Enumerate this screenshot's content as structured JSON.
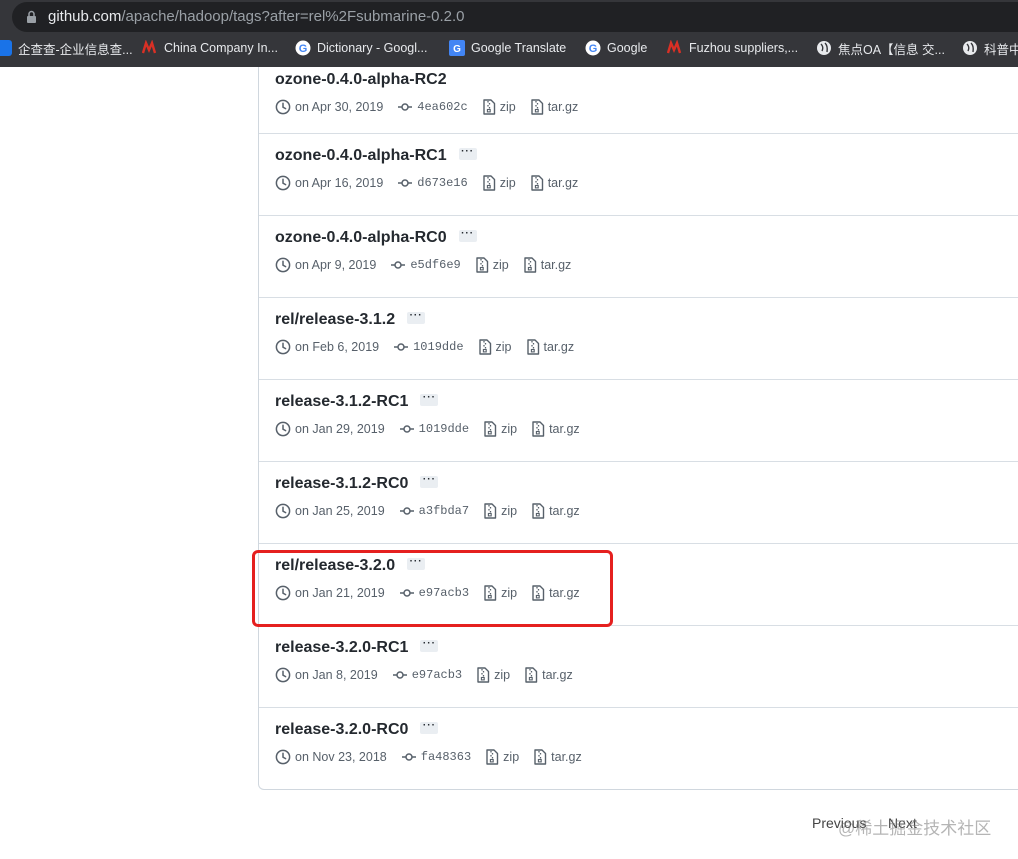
{
  "browser": {
    "url_host": "github.com",
    "url_path": "/apache/hadoop/tags?after=rel%2Fsubmarine-0.2.0",
    "bookmarks": [
      {
        "label": "企查查-企业信息查...",
        "icon": "qichacha-icon"
      },
      {
        "label": "China Company In...",
        "icon": "made-in-china-icon"
      },
      {
        "label": "Dictionary - Googl...",
        "icon": "google-icon"
      },
      {
        "label": "Google Translate",
        "icon": "google-translate-icon"
      },
      {
        "label": "Google",
        "icon": "google-icon"
      },
      {
        "label": "Fuzhou suppliers,...",
        "icon": "made-in-china-icon"
      },
      {
        "label": "焦点OA【信息 交...",
        "icon": "globe-icon"
      },
      {
        "label": "科普中",
        "icon": "globe-icon"
      }
    ]
  },
  "tags": [
    {
      "name": "ozone-0.4.0-alpha-RC2",
      "date": "on Apr 30, 2019",
      "sha": "4ea602c",
      "zip": "zip",
      "targz": "tar.gz"
    },
    {
      "name": "ozone-0.4.0-alpha-RC1",
      "date": "on Apr 16, 2019",
      "sha": "d673e16",
      "zip": "zip",
      "targz": "tar.gz"
    },
    {
      "name": "ozone-0.4.0-alpha-RC0",
      "date": "on Apr 9, 2019",
      "sha": "e5df6e9",
      "zip": "zip",
      "targz": "tar.gz"
    },
    {
      "name": "rel/release-3.1.2",
      "date": "on Feb 6, 2019",
      "sha": "1019dde",
      "zip": "zip",
      "targz": "tar.gz"
    },
    {
      "name": "release-3.1.2-RC1",
      "date": "on Jan 29, 2019",
      "sha": "1019dde",
      "zip": "zip",
      "targz": "tar.gz"
    },
    {
      "name": "release-3.1.2-RC0",
      "date": "on Jan 25, 2019",
      "sha": "a3fbda7",
      "zip": "zip",
      "targz": "tar.gz"
    },
    {
      "name": "rel/release-3.2.0",
      "date": "on Jan 21, 2019",
      "sha": "e97acb3",
      "zip": "zip",
      "targz": "tar.gz"
    },
    {
      "name": "release-3.2.0-RC1",
      "date": "on Jan 8, 2019",
      "sha": "e97acb3",
      "zip": "zip",
      "targz": "tar.gz"
    },
    {
      "name": "release-3.2.0-RC0",
      "date": "on Nov 23, 2018",
      "sha": "fa48363",
      "zip": "zip",
      "targz": "tar.gz"
    }
  ],
  "more_label": "···",
  "pagination": {
    "previous": "Previous",
    "next": "Next"
  },
  "watermark": "@稀土掘金技术社区",
  "colors": {
    "highlight": "#e5201f",
    "title": "#24292f",
    "meta": "#57606a"
  }
}
